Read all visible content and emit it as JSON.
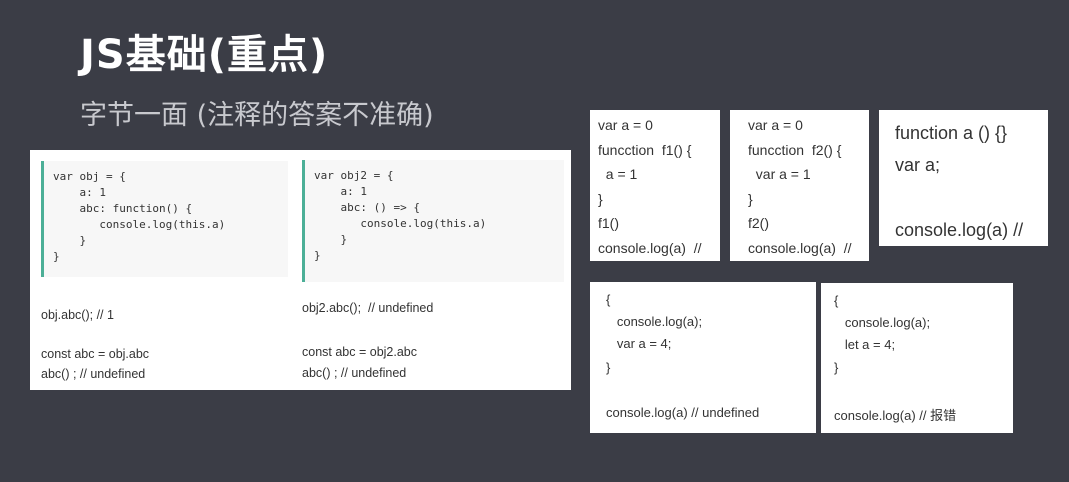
{
  "title": "JS基础(重点)",
  "subtitle": "字节一面 (注释的答案不准确)",
  "panel": {
    "code_left": [
      "var obj = {",
      "    a: 1",
      "    abc: function() {",
      "       console.log(this.a)",
      "    }",
      "}"
    ],
    "code_right": [
      "var obj2 = {",
      "    a: 1",
      "    abc: () => {",
      "       console.log(this.a)",
      "    }",
      "}"
    ],
    "left_call": "obj.abc(); // 1",
    "left_const": "const abc = obj.abc",
    "left_result": "abc() ; // undefined",
    "right_call": "obj2.abc();  // undefined",
    "right_const": "const abc = obj2.abc",
    "right_result": "abc() ; // undefined"
  },
  "cards": {
    "c1": [
      "var a = 0",
      "funcction  f1() {",
      "  a = 1",
      "}",
      "f1()",
      "console.log(a)  //"
    ],
    "c2": [
      "var a = 0",
      "funcction  f2() {",
      "  var a = 1",
      "}",
      "f2()",
      "console.log(a)  //"
    ],
    "c3": [
      "function a () {}",
      "var a;",
      "console.log(a) //"
    ],
    "c4": [
      "{",
      "   console.log(a);",
      "   var a = 4;",
      "}",
      "console.log(a) // undefined"
    ],
    "c5": [
      "{",
      "   console.log(a);",
      "   let a = 4;",
      "}",
      "console.log(a) // 报错"
    ]
  }
}
